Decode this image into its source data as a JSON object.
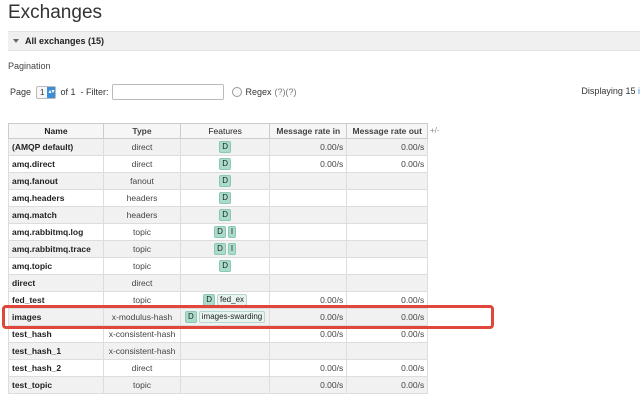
{
  "page": {
    "title": "Exchanges"
  },
  "section": {
    "title": "All exchanges (15)"
  },
  "pagination": {
    "label": "Pagination",
    "page_label": "Page",
    "page_value": "1",
    "of_label": "of 1",
    "filter_label": "- Filter:",
    "filter_value": "",
    "regex_label": "Regex",
    "regex_help": "(?)(?)",
    "displaying_label": "Displaying",
    "displaying_count": "15",
    "displaying_more": "i"
  },
  "table": {
    "headers": {
      "name": "Name",
      "type": "Type",
      "features": "Features",
      "rate_in": "Message rate in",
      "rate_out": "Message rate out"
    },
    "toggle_columns": "+/-",
    "rows": [
      {
        "name": "(AMQP default)",
        "type": "direct",
        "features": [
          "D"
        ],
        "rate_in": "0.00/s",
        "rate_out": "0.00/s"
      },
      {
        "name": "amq.direct",
        "type": "direct",
        "features": [
          "D"
        ],
        "rate_in": "0.00/s",
        "rate_out": "0.00/s"
      },
      {
        "name": "amq.fanout",
        "type": "fanout",
        "features": [
          "D"
        ],
        "rate_in": "",
        "rate_out": ""
      },
      {
        "name": "amq.headers",
        "type": "headers",
        "features": [
          "D"
        ],
        "rate_in": "",
        "rate_out": ""
      },
      {
        "name": "amq.match",
        "type": "headers",
        "features": [
          "D"
        ],
        "rate_in": "",
        "rate_out": ""
      },
      {
        "name": "amq.rabbitmq.log",
        "type": "topic",
        "features": [
          "D",
          "I"
        ],
        "rate_in": "",
        "rate_out": ""
      },
      {
        "name": "amq.rabbitmq.trace",
        "type": "topic",
        "features": [
          "D",
          "I"
        ],
        "rate_in": "",
        "rate_out": ""
      },
      {
        "name": "amq.topic",
        "type": "topic",
        "features": [
          "D"
        ],
        "rate_in": "",
        "rate_out": ""
      },
      {
        "name": "direct",
        "type": "direct",
        "features": [],
        "rate_in": "",
        "rate_out": ""
      },
      {
        "name": "fed_test",
        "type": "topic",
        "features": [
          "D",
          "fed_ex"
        ],
        "rate_in": "0.00/s",
        "rate_out": "0.00/s"
      },
      {
        "name": "images",
        "type": "x-modulus-hash",
        "features": [
          "D",
          "images-swarding"
        ],
        "rate_in": "0.00/s",
        "rate_out": "0.00/s"
      },
      {
        "name": "test_hash",
        "type": "x-consistent-hash",
        "features": [],
        "rate_in": "0.00/s",
        "rate_out": "0.00/s"
      },
      {
        "name": "test_hash_1",
        "type": "x-consistent-hash",
        "features": [],
        "rate_in": "",
        "rate_out": ""
      },
      {
        "name": "test_hash_2",
        "type": "direct",
        "features": [],
        "rate_in": "0.00/s",
        "rate_out": "0.00/s"
      },
      {
        "name": "test_topic",
        "type": "topic",
        "features": [],
        "rate_in": "0.00/s",
        "rate_out": "0.00/s"
      }
    ]
  },
  "highlight": {
    "color": "#e0463a",
    "row": "images"
  }
}
